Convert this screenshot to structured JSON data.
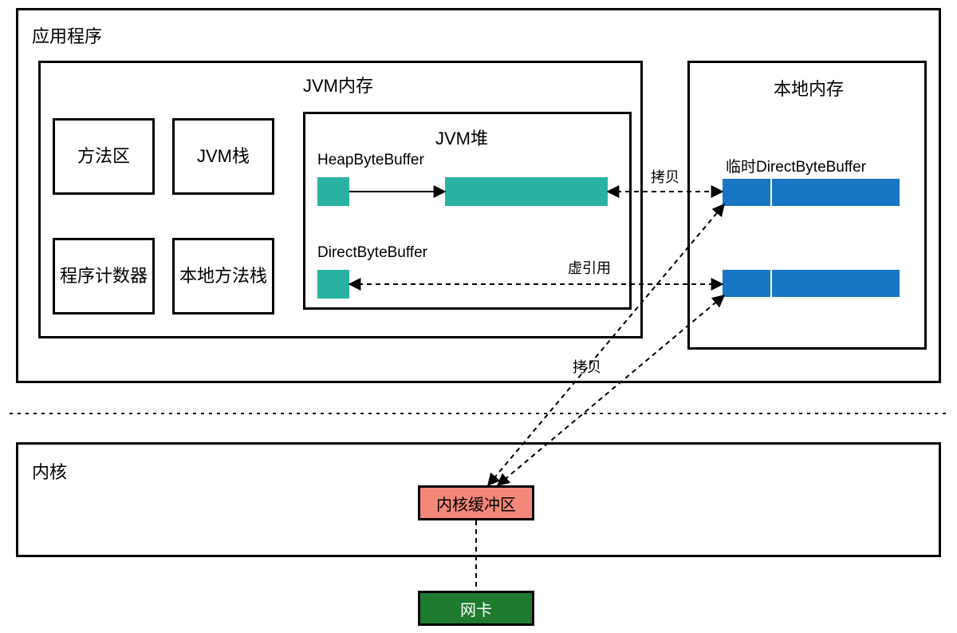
{
  "diagram": {
    "app_layer": "应用程序",
    "jvm_memory": "JVM内存",
    "native_memory": "本地内存",
    "method_area": "方法区",
    "jvm_stack": "JVM栈",
    "pc_register": "程序计数器",
    "native_stack": "本地方法栈",
    "jvm_heap": "JVM堆",
    "heap_byte_buffer": "HeapByteBuffer",
    "direct_byte_buffer": "DirectByteBuffer",
    "temp_direct_byte_buffer": "临时DirectByteBuffer",
    "copy_label": "拷贝",
    "phantom_ref_label": "虚引用",
    "kernel": "内核",
    "kernel_buffer": "内核缓冲区",
    "nic": "网卡"
  },
  "colors": {
    "teal": "#29b2a1",
    "blue": "#1976c5",
    "salmon": "#f3877a",
    "green": "#1d7a2e",
    "border": "#000000"
  }
}
